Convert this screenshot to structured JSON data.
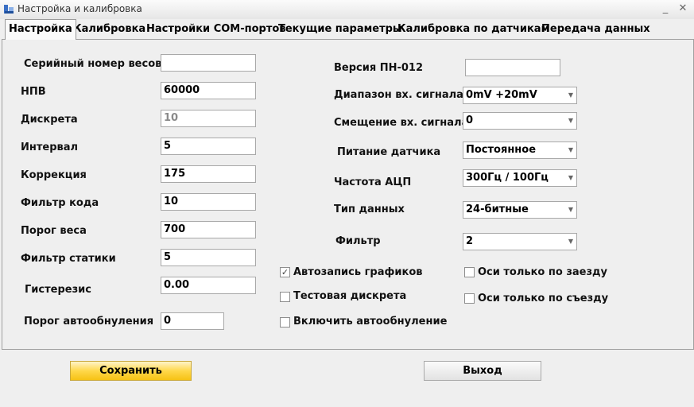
{
  "window": {
    "title": "Настройка и калибровка",
    "minimize_glyph": "_",
    "close_glyph": "✕"
  },
  "tabs": [
    {
      "label": "Настройка"
    },
    {
      "label": "Калибровка"
    },
    {
      "label": "Настройки COM-портов"
    },
    {
      "label": "Текущие параметры"
    },
    {
      "label": "Калибровка по датчикам"
    },
    {
      "label": "Передача данных"
    }
  ],
  "left_fields": [
    {
      "label": "Серийный номер весов",
      "value": ""
    },
    {
      "label": "НПВ",
      "value": "60000"
    },
    {
      "label": "Дискрета",
      "value": "10"
    },
    {
      "label": "Интервал",
      "value": "5"
    },
    {
      "label": "Коррекция",
      "value": "175"
    },
    {
      "label": "Фильтр кода",
      "value": "10"
    },
    {
      "label": "Порог веса",
      "value": "700"
    },
    {
      "label": "Фильтр статики",
      "value": "5"
    },
    {
      "label": "Гистерезис",
      "value": "0.00"
    },
    {
      "label": "Порог автообнуления",
      "value": "0"
    }
  ],
  "right_fields": {
    "version": {
      "label": "Версия ПН-012",
      "value": ""
    },
    "combos": [
      {
        "label": "Диапазон вх. сигнала",
        "value": "0mV +20mV"
      },
      {
        "label": "Смещение вх. сигнала",
        "value": "0"
      },
      {
        "label": "Питание датчика",
        "value": "Постоянное"
      },
      {
        "label": "Частота АЦП",
        "value": "300Гц / 100Гц"
      },
      {
        "label": "Тип данных",
        "value": "24-битные"
      },
      {
        "label": "Фильтр",
        "value": "2"
      }
    ]
  },
  "checkboxes": [
    {
      "label": "Автозапись графиков",
      "checked": true,
      "mark": "✓"
    },
    {
      "label": "Тестовая дискрета",
      "checked": false,
      "mark": ""
    },
    {
      "label": "Включить автообнуление",
      "checked": false,
      "mark": ""
    },
    {
      "label": "Оси только по заезду",
      "checked": false,
      "mark": ""
    },
    {
      "label": "Оси только по съезду",
      "checked": false,
      "mark": ""
    }
  ],
  "buttons": {
    "save": "Сохранить",
    "exit": "Выход"
  },
  "colors": {
    "accent_button": "#ffd84a",
    "background": "#efefef"
  }
}
